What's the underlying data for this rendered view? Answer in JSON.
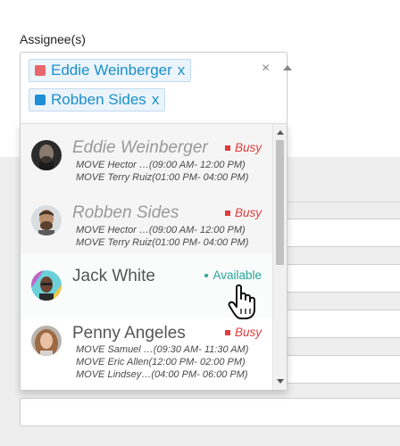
{
  "field": {
    "label": "Assignee(s)"
  },
  "selected_tags": [
    {
      "name": "Eddie Weinberger",
      "remove": "x",
      "color": "#e8676c"
    },
    {
      "name": "Robben Sides",
      "remove": "x",
      "color": "#1e8fd6"
    }
  ],
  "controls": {
    "clear": "×"
  },
  "options": [
    {
      "name": "Eddie Weinberger",
      "status": "Busy",
      "state": "disabled",
      "moves": [
        "MOVE Hector …(09:00 AM- 12:00 PM)",
        "MOVE Terry Ruiz(01:00 PM- 04:00 PM)"
      ]
    },
    {
      "name": "Robben Sides",
      "status": "Busy",
      "state": "disabled",
      "moves": [
        "MOVE Hector …(09:00 AM- 12:00 PM)",
        "MOVE Terry Ruiz(01:00 PM- 04:00 PM)"
      ]
    },
    {
      "name": "Jack White",
      "status": "Available",
      "state": "enabled",
      "moves": []
    },
    {
      "name": "Penny Angeles",
      "status": "Busy",
      "state": "enabled",
      "moves": [
        "MOVE Samuel …(09:30 AM- 11:30 AM)",
        "MOVE Eric Allen(12:00 PM- 02:00 PM)",
        "MOVE Lindsey…(04:00 PM- 06:00 PM)"
      ]
    }
  ],
  "colors": {
    "busy": "#e23b3b",
    "available": "#2aa79a",
    "tag_text": "#1a8fcb"
  }
}
